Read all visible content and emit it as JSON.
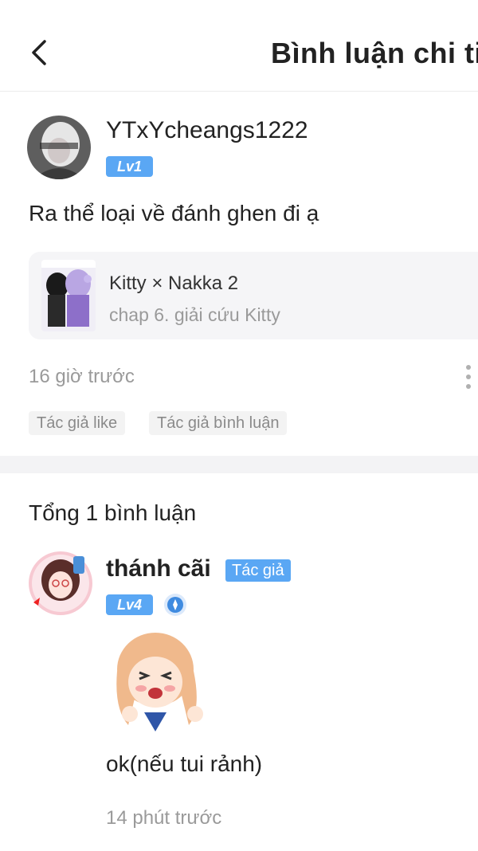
{
  "header": {
    "title": "Bình luận chi ti"
  },
  "comment": {
    "username": "YTxYcheangs1222",
    "level": "Lv1",
    "text": "Ra thể loại về đánh ghen đi ạ",
    "time": "16 giờ trước",
    "tags": [
      "Tác giả like",
      "Tác giả bình luận"
    ]
  },
  "manga": {
    "title": "Kitty × Nakka 2",
    "chapter": "chap 6. giải cứu Kitty"
  },
  "replies": {
    "total_label": "Tổng 1 bình luận",
    "items": [
      {
        "username": "thánh cãi",
        "badge": "Tác giả",
        "level": "Lv4",
        "text": "ok(nếu tui rảnh)",
        "time": "14 phút trước"
      }
    ]
  },
  "colors": {
    "level_badge": "#5aa7f4",
    "muted_text": "#9a9a9a",
    "card_bg": "#f5f5f7"
  },
  "icons": {
    "back": "chevron-left-icon",
    "more": "more-vertical-icon",
    "medal": "medal-icon"
  }
}
